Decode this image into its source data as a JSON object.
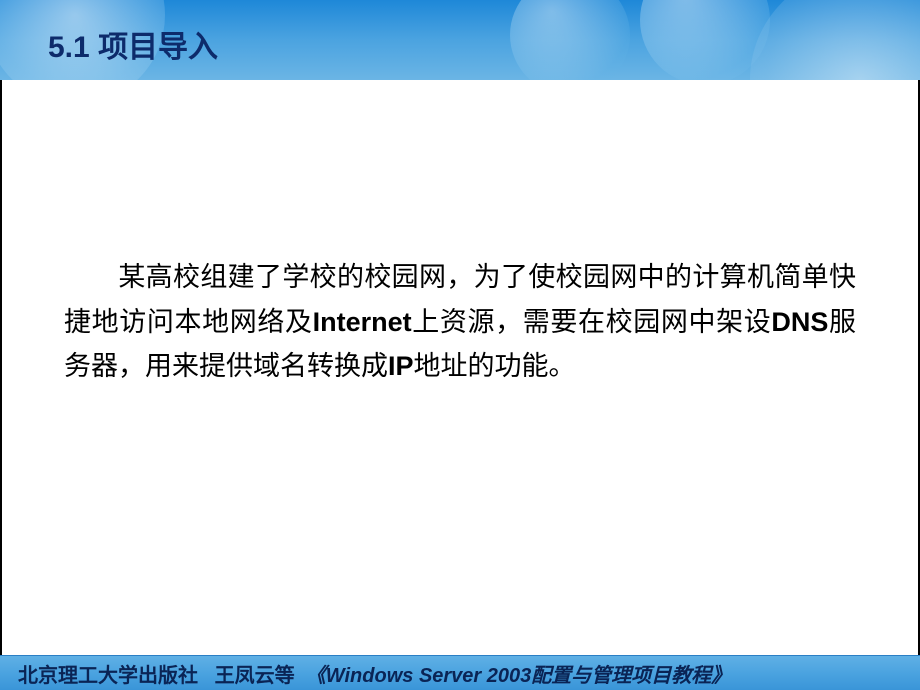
{
  "header": {
    "section_number": "5.1",
    "section_title": "项目导入"
  },
  "content": {
    "paragraph": "某高校组建了学校的校园网，为了使校园网中的计算机简单快捷地访问本地网络及",
    "term1": "Internet",
    "paragraph2": "上资源，需要在校园网中架设",
    "term2": "DNS",
    "paragraph3": "服务器，用来提供域名转换成",
    "term3": "IP",
    "paragraph4": "地址的功能。"
  },
  "footer": {
    "publisher": "北京理工大学出版社",
    "author": "王凤云等",
    "book_title": "《Windows Server 2003配置与管理项目教程》"
  }
}
